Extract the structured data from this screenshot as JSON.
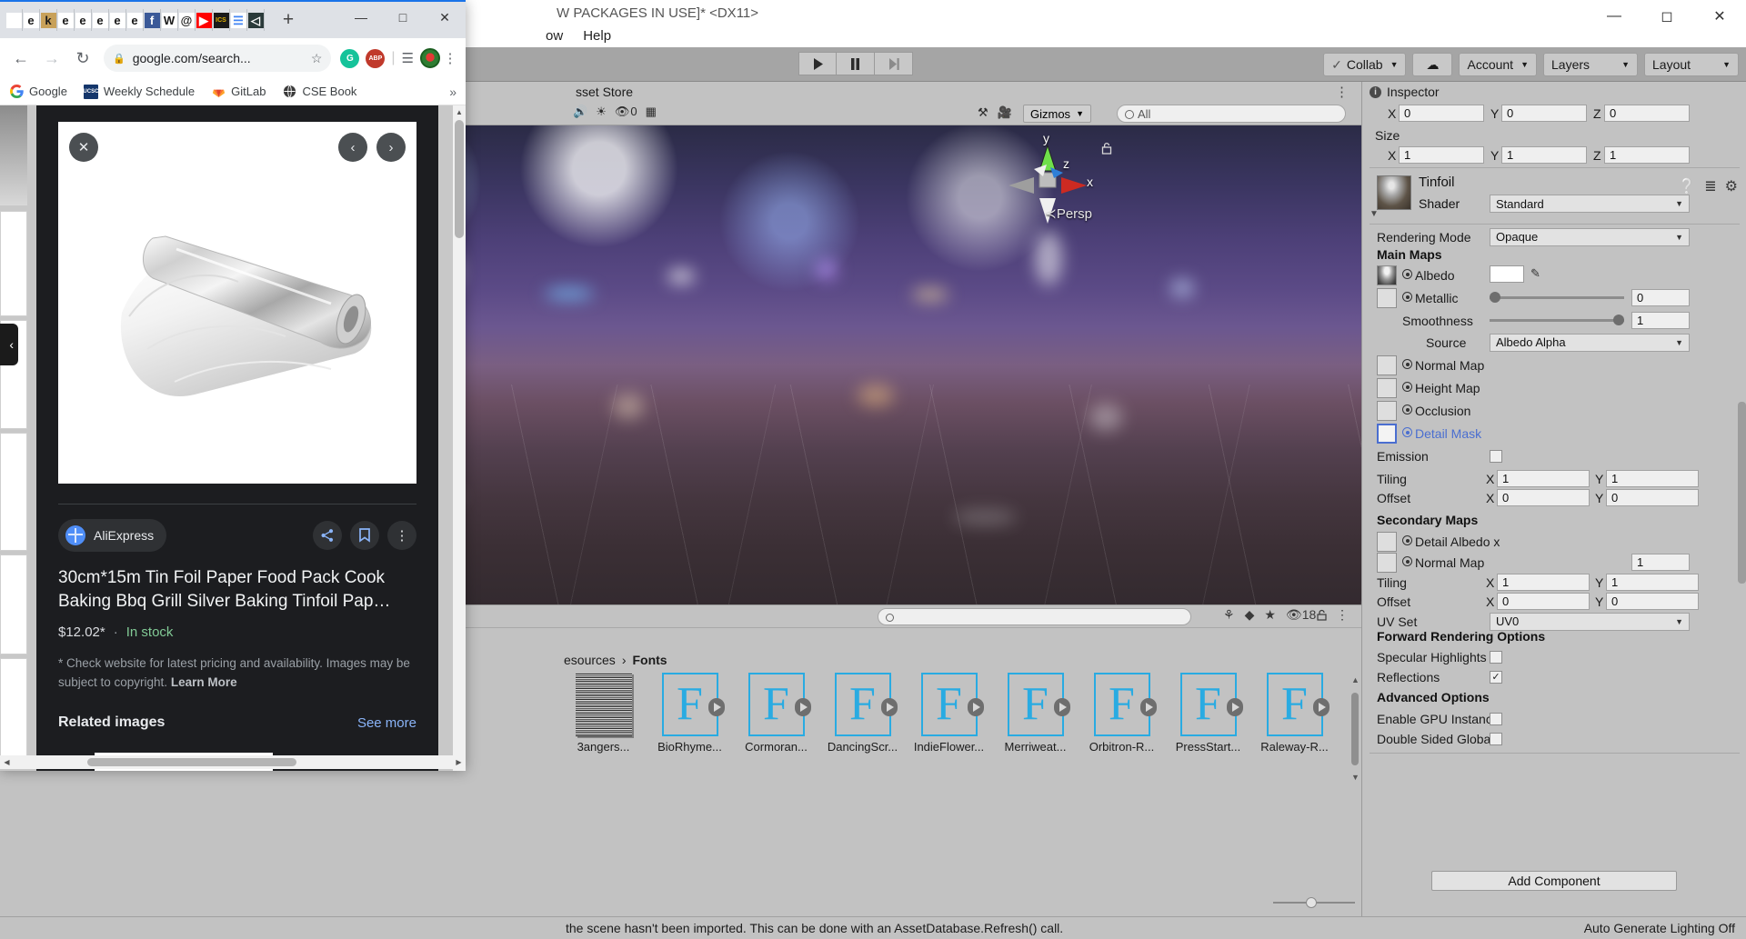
{
  "unity": {
    "window_title": "W PACKAGES IN USE]* <DX11>",
    "menu": [
      "ow",
      "Help"
    ],
    "toolbar": {
      "play": "play-icon",
      "pause": "pause-icon",
      "step": "step-icon",
      "collab": "Collab",
      "cloud": "cloud-icon",
      "account": "Account",
      "layers": "Layers",
      "layout": "Layout"
    },
    "scene_tab_label": "sset Store",
    "scene_toolbar": {
      "gizmos": "Gizmos",
      "search_placeholder": "All"
    },
    "scene_view": {
      "axis_x": "x",
      "axis_y": "y",
      "axis_z": "z",
      "projection": "Persp"
    },
    "project_browser": {
      "breadcrumb": [
        "esources",
        "Fonts"
      ],
      "visible_count": "18",
      "assets": [
        {
          "name": "3angers...",
          "icon": "noise-texture-icon"
        },
        {
          "name": "BioRhyme...",
          "icon": "font-F-icon"
        },
        {
          "name": "Cormoran...",
          "icon": "font-F-icon"
        },
        {
          "name": "DancingScr...",
          "icon": "font-F-icon"
        },
        {
          "name": "IndieFlower...",
          "icon": "font-F-icon"
        },
        {
          "name": "Merriweat...",
          "icon": "font-F-icon"
        },
        {
          "name": "Orbitron-R...",
          "icon": "font-F-icon"
        },
        {
          "name": "PressStart...",
          "icon": "font-F-icon"
        },
        {
          "name": "Raleway-R...",
          "icon": "font-F-icon"
        }
      ]
    },
    "status": {
      "message": "the scene hasn't been imported. This can be done with an AssetDatabase.Refresh() call.",
      "lighting": "Auto Generate Lighting Off"
    },
    "inspector": {
      "tab_label": "Inspector",
      "transform": {
        "position": {
          "x_label": "X",
          "x": "0",
          "y_label": "Y",
          "y": "0",
          "z_label": "Z",
          "z": "0"
        },
        "size_label": "Size",
        "size": {
          "x_label": "X",
          "x": "1",
          "y_label": "Y",
          "y": "1",
          "z_label": "Z",
          "z": "1"
        }
      },
      "material": {
        "name": "Tinfoil",
        "shader_label": "Shader",
        "shader_value": "Standard",
        "rendering_mode_label": "Rendering Mode",
        "rendering_mode_value": "Opaque",
        "main_maps_label": "Main Maps",
        "albedo_label": "Albedo",
        "metallic_label": "Metallic",
        "metallic_value": "0",
        "smoothness_label": "Smoothness",
        "smoothness_value": "1",
        "source_label": "Source",
        "source_value": "Albedo Alpha",
        "normal_map_label": "Normal Map",
        "height_map_label": "Height Map",
        "occlusion_label": "Occlusion",
        "detail_mask_label": "Detail Mask",
        "emission_label": "Emission",
        "tiling_label": "Tiling",
        "tiling": {
          "x_label": "X",
          "x": "1",
          "y_label": "Y",
          "y": "1"
        },
        "offset_label": "Offset",
        "offset": {
          "x_label": "X",
          "x": "0",
          "y_label": "Y",
          "y": "0"
        },
        "secondary_maps_label": "Secondary Maps",
        "detail_albedo_label": "Detail Albedo x",
        "secondary_normal_label": "Normal Map",
        "secondary_normal_value": "1",
        "sec_tiling_label": "Tiling",
        "sec_tiling": {
          "x_label": "X",
          "x": "1",
          "y_label": "Y",
          "y": "1"
        },
        "sec_offset_label": "Offset",
        "sec_offset": {
          "x_label": "X",
          "x": "0",
          "y_label": "Y",
          "y": "0"
        },
        "uv_set_label": "UV Set",
        "uv_set_value": "UV0",
        "forward_rendering_label": "Forward Rendering Options",
        "specular_highlights_label": "Specular Highlights",
        "reflections_label": "Reflections",
        "reflections_checked": "✓",
        "advanced_options_label": "Advanced Options",
        "gpu_instancing_label": "Enable GPU Instancin",
        "double_sided_label": "Double Sided Global"
      },
      "add_component": "Add Component",
      "accent_blue": "#4a6ed0"
    }
  },
  "chrome": {
    "tabs": [
      {
        "icon": "ᵛ",
        "label": "library-icon",
        "color": "#ffffff",
        "bg": "#ffffff"
      },
      {
        "icon": "e",
        "label": "e-icon",
        "color": "#1a1a1a",
        "bg": "#ffffff"
      },
      {
        "icon": "k",
        "label": "k-icon",
        "color": "#1a1a1a",
        "bg": "#c8a15a"
      },
      {
        "icon": "e",
        "label": "e-icon",
        "color": "#1a1a1a",
        "bg": "#ffffff"
      },
      {
        "icon": "e",
        "label": "e-icon",
        "color": "#1a1a1a",
        "bg": "#ffffff"
      },
      {
        "icon": "e",
        "label": "e-icon",
        "color": "#1a1a1a",
        "bg": "#ffffff"
      },
      {
        "icon": "e",
        "label": "e-icon",
        "color": "#1a1a1a",
        "bg": "#ffffff"
      },
      {
        "icon": "e",
        "label": "e-icon",
        "color": "#1a1a1a",
        "bg": "#ffffff"
      },
      {
        "icon": "f",
        "label": "facebook-icon",
        "color": "#ffffff",
        "bg": "#3b5998"
      },
      {
        "icon": "W",
        "label": "wikipedia-icon",
        "color": "#1a1a1a",
        "bg": "#ffffff"
      },
      {
        "icon": "@",
        "label": "mail-icon",
        "color": "#1a1a1a",
        "bg": "#ffffff"
      },
      {
        "icon": "▶",
        "label": "youtube-icon",
        "color": "#ffffff",
        "bg": "#ff0000"
      },
      {
        "icon": "ICS",
        "label": "ics-icon",
        "color": "#e0b000",
        "bg": "#1a1a1a"
      },
      {
        "icon": "☰",
        "label": "docs-icon",
        "color": "#4285f4",
        "bg": "#ffffff"
      },
      {
        "icon": "◁",
        "label": "unity-icon",
        "color": "#ffffff",
        "bg": "#2a3a3a"
      }
    ],
    "new_tab": "+",
    "window_controls": {
      "minimize": "—",
      "maximize": "□",
      "close": "✕"
    },
    "nav": {
      "back": "←",
      "forward": "→",
      "reload": "↻"
    },
    "omnibox": {
      "value": "google.com/search...",
      "lock": "🔒",
      "star": "☆"
    },
    "extensions": [
      {
        "name": "grammarly-icon",
        "glyph": "G",
        "color": "#15c39a"
      },
      {
        "name": "adblock-icon",
        "glyph": "ABP",
        "color": "#c0392b"
      }
    ],
    "reading_list_icon": "reading-list-icon",
    "profile_icon": "profile-avatar",
    "menu_icon": "⋮",
    "bookmarks": [
      {
        "label": "Google",
        "icon": "google-icon"
      },
      {
        "label": "Weekly Schedule",
        "icon": "ucsc-icon"
      },
      {
        "label": "GitLab",
        "icon": "gitlab-icon"
      },
      {
        "label": "CSE Book",
        "icon": "globe-icon"
      }
    ],
    "bookmarks_overflow": "»",
    "result_card": {
      "close_icon": "✕",
      "prev_icon": "‹",
      "next_icon": "›",
      "source": "AliExpress",
      "actions": [
        {
          "name": "share-button",
          "glyph": "share-icon"
        },
        {
          "name": "bookmark-button",
          "glyph": "bookmark-icon"
        },
        {
          "name": "more-options-button",
          "glyph": "⋮"
        }
      ],
      "title": "30cm*15m Tin Foil Paper Food Pack Cook Baking Bbq Grill Silver Baking Tinfoil Pap…",
      "price": "$12.02*",
      "separator": "·",
      "stock": "In stock",
      "disclaimer_text": "* Check website for latest pricing and availability. Images may be subject to copyright. ",
      "learn_more": "Learn More",
      "related_title": "Related images",
      "see_more": "See more"
    }
  }
}
